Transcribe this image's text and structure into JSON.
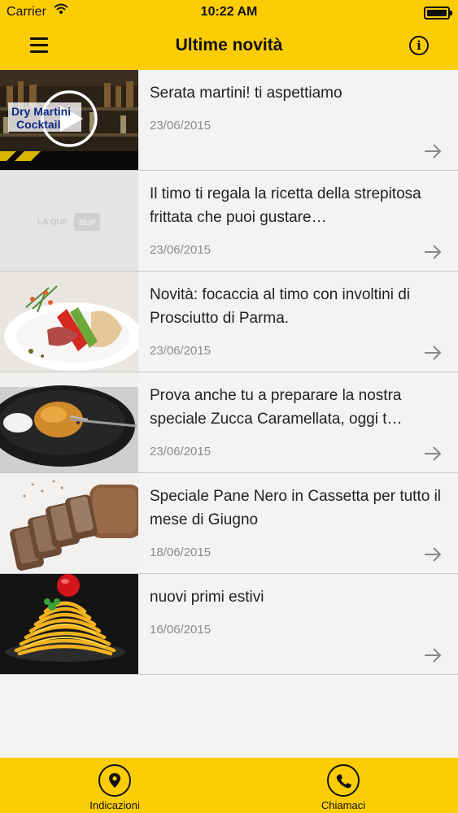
{
  "status_bar": {
    "carrier": "Carrier",
    "time": "10:22 AM"
  },
  "nav": {
    "title": "Ultime novità",
    "left_icon": "menu-icon",
    "right_icon": "info-icon"
  },
  "news": [
    {
      "title": "Serata martini! ti aspettiamo",
      "date": "23/06/2015",
      "thumb_text": "Dry Martini Cocktail"
    },
    {
      "title": "Il timo ti regala la ricetta della strepitosa frittata che puoi gustare…",
      "date": "23/06/2015",
      "thumb_text": "LA QUE BUP"
    },
    {
      "title": "Novità: focaccia al timo con involtini di Prosciutto di Parma.",
      "date": "23/06/2015"
    },
    {
      "title": "Prova anche tu a preparare la nostra speciale Zucca Caramellata, oggi t…",
      "date": "23/06/2015"
    },
    {
      "title": "Speciale Pane Nero in Cassetta per tutto il mese di Giugno",
      "date": "18/06/2015"
    },
    {
      "title": "nuovi primi estivi",
      "date": "16/06/2015"
    }
  ],
  "tabs": [
    {
      "label": "Indicazioni",
      "icon": "location-pin-icon"
    },
    {
      "label": "Chiamaci",
      "icon": "phone-icon"
    }
  ]
}
